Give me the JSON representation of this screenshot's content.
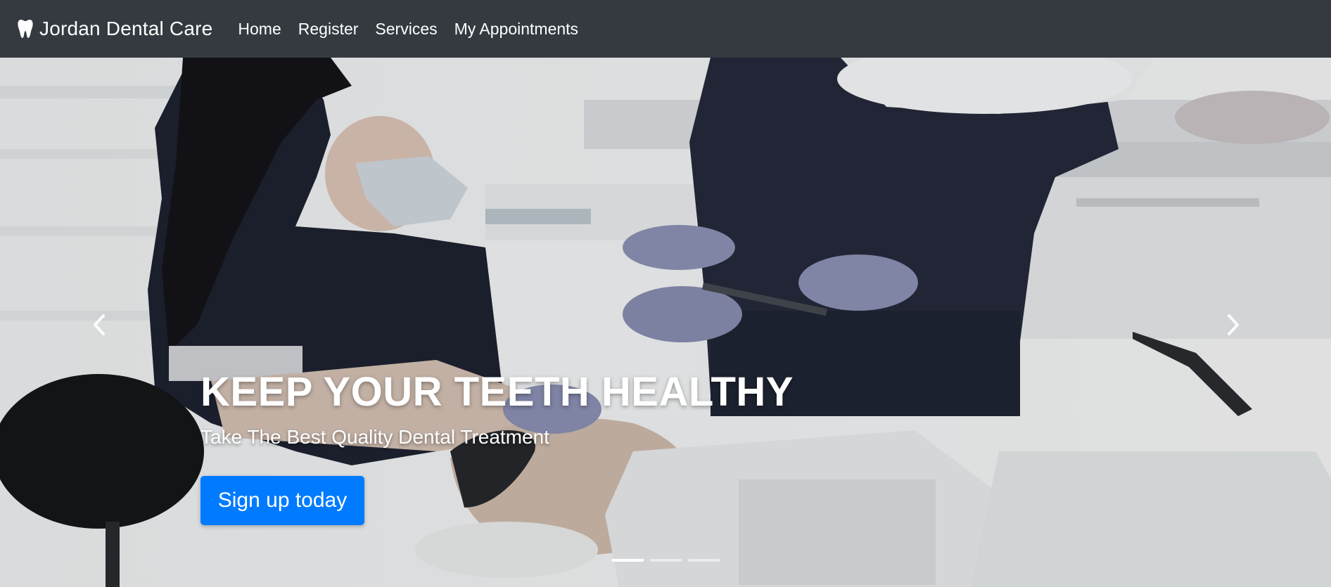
{
  "navbar": {
    "brand_icon": "tooth-icon",
    "brand": "Jordan Dental Care",
    "links": [
      {
        "label": "Home"
      },
      {
        "label": "Register"
      },
      {
        "label": "Services"
      },
      {
        "label": "My Appointments"
      }
    ],
    "background": "#343a40"
  },
  "carousel": {
    "slide": {
      "image": "dentist-treating-patient-photo",
      "headline": "KEEP YOUR TEETH HEALTHY",
      "subheadline": "Take The Best Quality Dental Treatment",
      "cta_label": "Sign up today",
      "cta_color": "#007bff"
    },
    "prev_icon": "chevron-left-icon",
    "next_icon": "chevron-right-icon",
    "indicator_count": 3,
    "active_indicator": 1
  }
}
